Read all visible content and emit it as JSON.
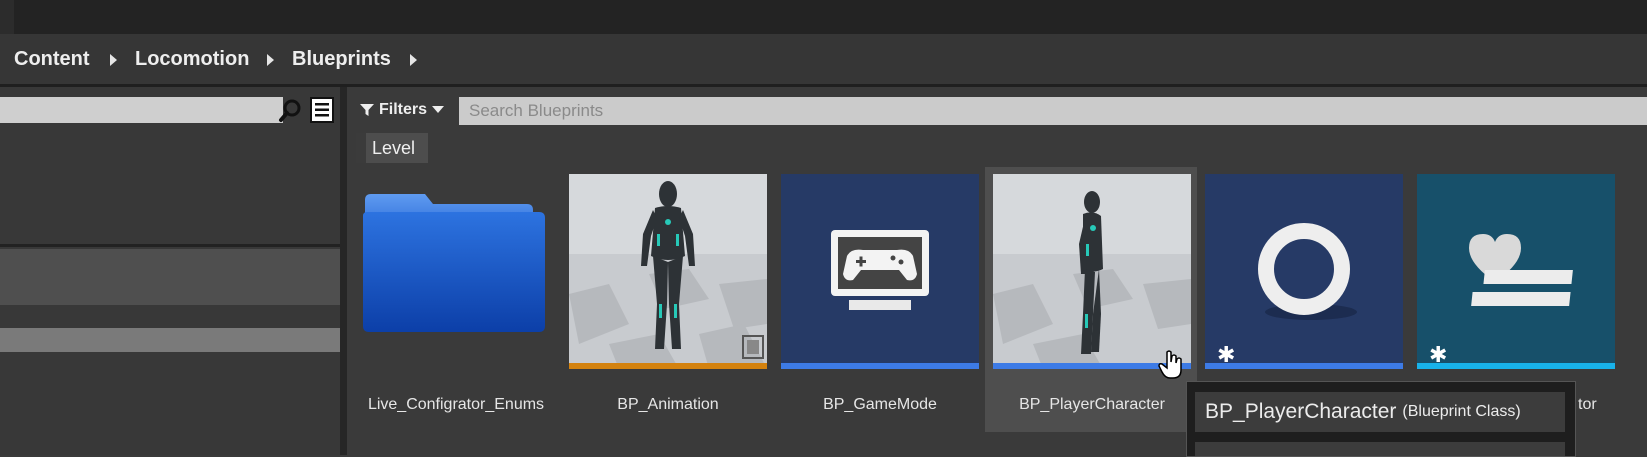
{
  "breadcrumb": [
    "Content",
    "Locomotion",
    "Blueprints"
  ],
  "filters": {
    "label": "Filters"
  },
  "search": {
    "placeholder": "Search Blueprints"
  },
  "chips": {
    "level": "Level"
  },
  "assets": [
    {
      "name": "Live_Configrator_Enums",
      "icon": "folder-icon"
    },
    {
      "name": "BP_Animation",
      "icon": "character-thumbnail",
      "strip_color": "#d4820e"
    },
    {
      "name": "BP_GameMode",
      "icon": "gamepad-monitor-icon",
      "strip_color": "#3d7be6"
    },
    {
      "name": "BP_PlayerCharacter",
      "icon": "character-thumbnail",
      "strip_color": "#3d7be6"
    },
    {
      "name": "",
      "icon": "ring-icon",
      "strip_color": "#3d7be6"
    },
    {
      "name": "",
      "icon": "heart-list-icon",
      "strip_color": "#18b2ea"
    }
  ],
  "partial_label": "tor",
  "tooltip": {
    "name": "BP_PlayerCharacter",
    "type": "(Blueprint Class)"
  }
}
